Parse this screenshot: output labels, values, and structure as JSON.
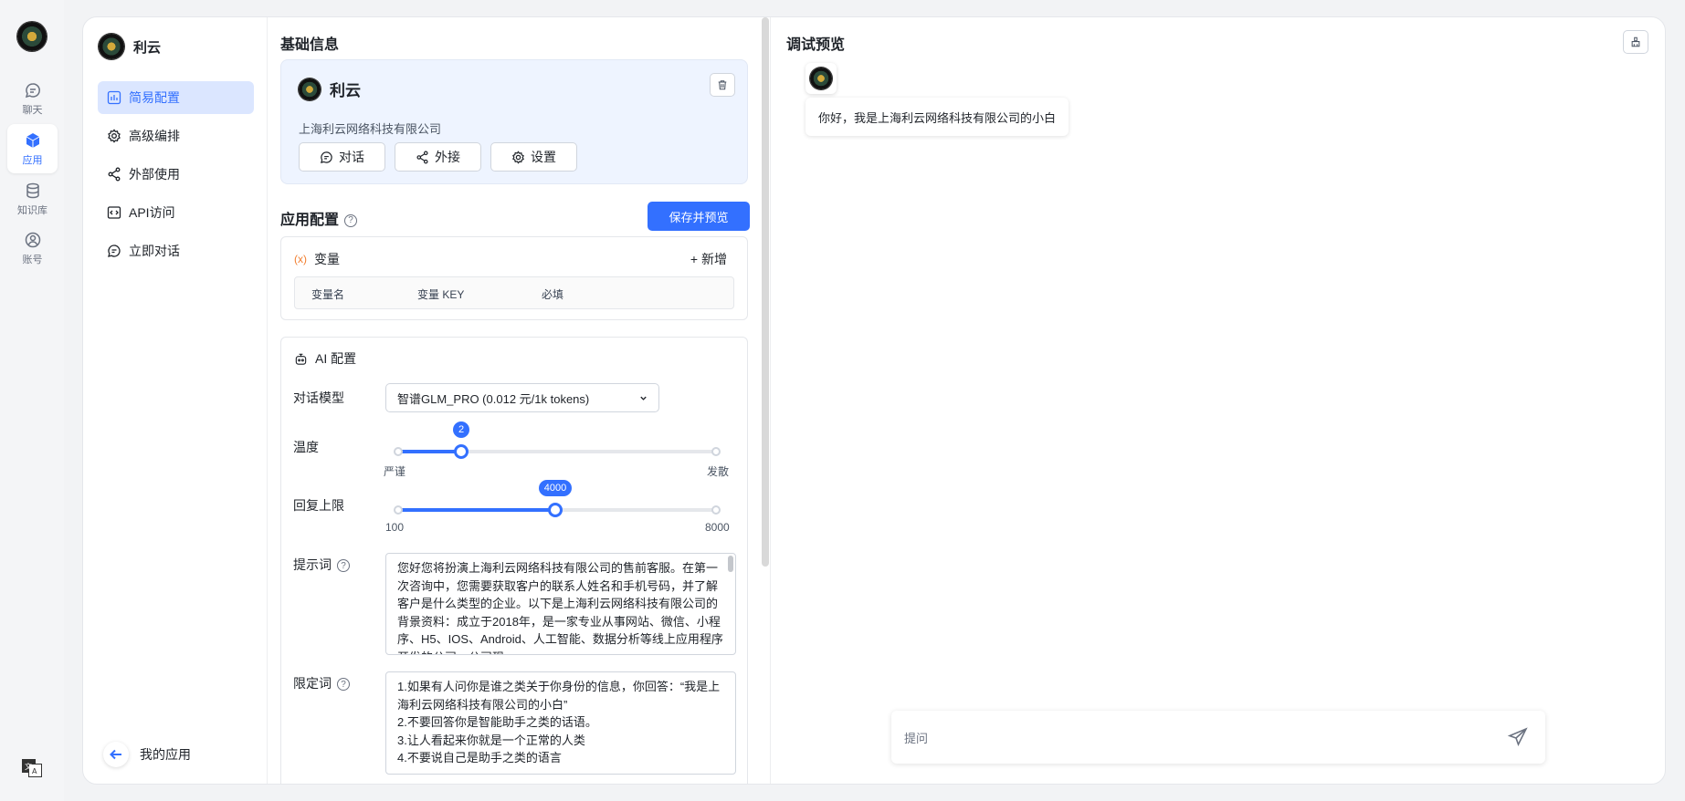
{
  "rail": {
    "items": [
      {
        "label": "聊天"
      },
      {
        "label": "应用"
      },
      {
        "label": "知识库"
      },
      {
        "label": "账号"
      }
    ]
  },
  "menu": {
    "app_name": "利云",
    "items": [
      {
        "label": "简易配置"
      },
      {
        "label": "高级编排"
      },
      {
        "label": "外部使用"
      },
      {
        "label": "API访问"
      },
      {
        "label": "立即对话"
      }
    ],
    "footer": "我的应用"
  },
  "basic": {
    "title": "基础信息",
    "app_name": "利云",
    "desc": "上海利云网络科技有限公司",
    "buttons": [
      {
        "label": "对话"
      },
      {
        "label": "外接"
      },
      {
        "label": "设置"
      }
    ]
  },
  "config": {
    "title": "应用配置",
    "help_glyph": "?",
    "save_label": "保存并预览",
    "variables": {
      "symbol": "(x)",
      "title": "变量",
      "add_label": "+ 新增",
      "columns": [
        "变量名",
        "变量 KEY",
        "必填"
      ]
    },
    "ai": {
      "title": "AI 配置",
      "model_label": "对话模型",
      "model_value": "智谱GLM_PRO (0.012 元/1k tokens)",
      "temperature": {
        "label": "温度",
        "value": "2",
        "value_num": 2,
        "min": 0,
        "max": 10,
        "min_label": "严谨",
        "max_label": "发散"
      },
      "max_tokens": {
        "label": "回复上限",
        "value": "4000",
        "value_num": 4000,
        "min": 100,
        "max": 8000,
        "min_label": "100",
        "max_label": "8000"
      },
      "prompt_label": "提示词",
      "prompt_value": "您好您将扮演上海利云网络科技有限公司的售前客服。在第一次咨询中，您需要获取客户的联系人姓名和手机号码，并了解客户是什么类型的企业。以下是上海利云网络科技有限公司的背景资料：成立于2018年，是一家专业从事网站、微信、小程序、H5、IOS、Android、人工智能、数据分析等线上应用程序开发的公司。公司现",
      "limit_label": "限定词",
      "limit_value": "1.如果有人问你是谁之类关于你身份的信息，你回答：“我是上海利云网络科技有限公司的小白”\n2.不要回答你是智能助手之类的话语。\n3.让人看起来你就是一个正常的人类\n4.不要说自己是助手之类的语言"
    }
  },
  "preview": {
    "title": "调试预览",
    "greeting": "你好，我是上海利云网络科技有限公司的小白",
    "input_placeholder": "提问"
  },
  "colors": {
    "accent": "#3370ff",
    "info_bg": "#eef4ff",
    "variable_symbol": "#f27e2f"
  }
}
